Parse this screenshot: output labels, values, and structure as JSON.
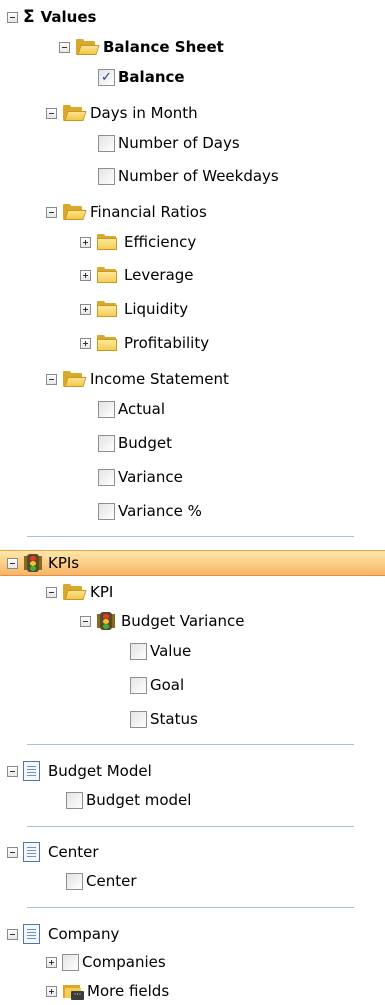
{
  "tree": {
    "values_label": "Values",
    "balance_sheet_label": "Balance Sheet",
    "balance_label": "Balance",
    "days_in_month_label": "Days in Month",
    "number_of_days_label": "Number of Days",
    "number_of_weekdays_label": "Number of Weekdays",
    "financial_ratios_label": "Financial Ratios",
    "efficiency_label": "Efficiency",
    "leverage_label": "Leverage",
    "liquidity_label": "Liquidity",
    "profitability_label": "Profitability",
    "income_statement_label": "Income Statement",
    "actual_label": "Actual",
    "budget_label": "Budget",
    "variance_label": "Variance",
    "variance_pct_label": "Variance %",
    "kpis_label": "KPIs",
    "kpi_label": "KPI",
    "budget_variance_label": "Budget Variance",
    "value_label": "Value",
    "goal_label": "Goal",
    "status_label": "Status",
    "budget_model_table_label": "Budget Model",
    "budget_model_field_label": "Budget model",
    "center_table_label": "Center",
    "center_field_label": "Center",
    "company_table_label": "Company",
    "companies_label": "Companies",
    "more_fields_label": "More fields"
  },
  "checked": {
    "balance": true
  },
  "check_glyph": "✓",
  "colors": {
    "highlight": "#f8b568",
    "separator": "#a7c0e0",
    "folder": "#f5cd55",
    "checkmark": "#1f3f8f"
  }
}
